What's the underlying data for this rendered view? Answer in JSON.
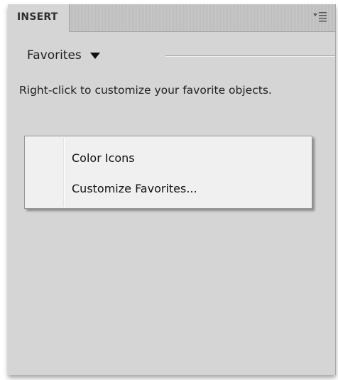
{
  "panel": {
    "tab_label": "INSERT",
    "menu_icon": "panel-options-icon"
  },
  "favorites": {
    "label": "Favorites",
    "arrow_icon": "dropdown-triangle-icon"
  },
  "hint": {
    "text": "Right-click to customize your favorite objects."
  },
  "context_menu": {
    "items": [
      {
        "label": "Color Icons"
      },
      {
        "label": "Customize Favorites..."
      }
    ]
  }
}
